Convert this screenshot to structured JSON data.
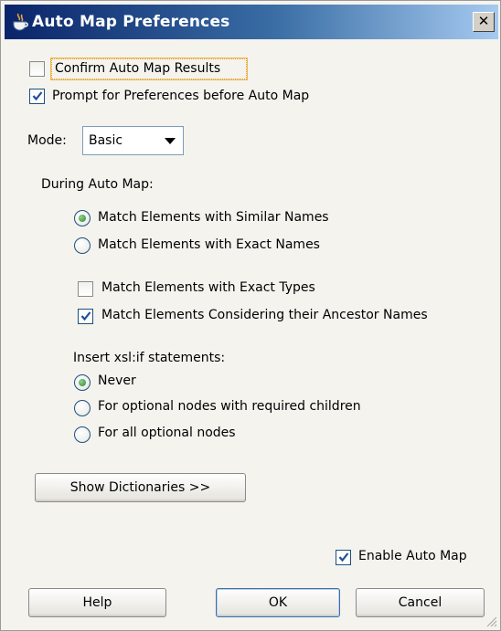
{
  "window": {
    "title": "Auto Map Preferences",
    "close_glyph": "✕"
  },
  "options": {
    "confirm_results": {
      "label": "Confirm Auto Map Results",
      "checked": false
    },
    "prompt_preferences": {
      "label": "Prompt for Preferences before Auto Map",
      "checked": true
    }
  },
  "mode": {
    "label": "Mode:",
    "selected": "Basic"
  },
  "during_auto_map": {
    "heading": "During Auto Map:",
    "similar_names": {
      "label": "Match Elements with Similar Names",
      "selected": true
    },
    "exact_names": {
      "label": "Match Elements with Exact Names",
      "selected": false
    },
    "exact_types": {
      "label": "Match Elements with Exact Types",
      "checked": false
    },
    "ancestor_names": {
      "label": "Match Elements Considering their Ancestor Names",
      "checked": true
    }
  },
  "xsl_if": {
    "heading": "Insert xsl:if statements:",
    "never": {
      "label": "Never",
      "selected": true
    },
    "optional_required_children": {
      "label": "For optional nodes with required children",
      "selected": false
    },
    "all_optional": {
      "label": "For all optional nodes",
      "selected": false
    }
  },
  "buttons": {
    "show_dictionaries": "Show Dictionaries >>",
    "help": "Help",
    "ok": "OK",
    "cancel": "Cancel"
  },
  "enable_auto_map": {
    "label": "Enable Auto Map",
    "checked": true
  },
  "colors": {
    "title_start": "#0a246a",
    "title_end": "#a6caf0",
    "dialog_bg": "#f4f3ee",
    "check_mark": "#1f4f9a",
    "radio_dot": "#2b8a2b"
  },
  "icons": {
    "title": "java-cup-icon",
    "close": "close-icon",
    "check": "checkmark-icon",
    "dropdown": "chevron-down-icon"
  }
}
